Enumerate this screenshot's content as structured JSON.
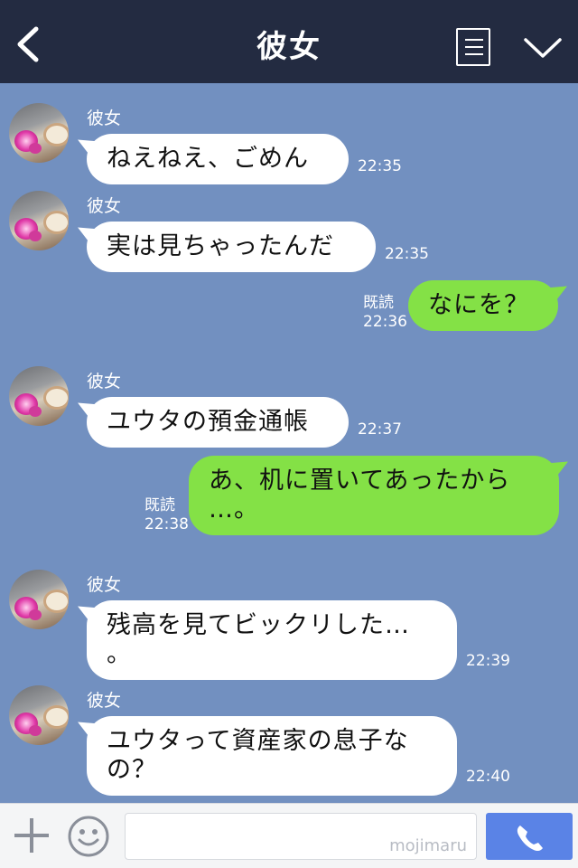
{
  "header": {
    "title": "彼女",
    "back_icon": "back-arrow-icon",
    "menu_icon": "list-menu-icon",
    "more_icon": "chevron-down-icon",
    "background": "#232b41"
  },
  "chat": {
    "background": "#7290c0",
    "incoming_bubble_color": "#ffffff",
    "outgoing_bubble_color": "#84e146",
    "messages": [
      {
        "direction": "in",
        "sender": "彼女",
        "text": "ねえねえ、ごめん",
        "time": "22:35"
      },
      {
        "direction": "in",
        "sender": "彼女",
        "text": "実は見ちゃったんだ",
        "time": "22:35"
      },
      {
        "direction": "out",
        "text": "なにを？",
        "read": "既読",
        "time": "22:36"
      },
      {
        "direction": "in",
        "sender": "彼女",
        "text": "ユウタの預金通帳",
        "time": "22:37"
      },
      {
        "direction": "out",
        "text_line1": "あ、机に置いてあったから",
        "text_line2": "…。",
        "read": "既読",
        "time": "22:38"
      },
      {
        "direction": "in",
        "sender": "彼女",
        "text_line1": "残高を見てビックリした…",
        "text_line2": "。",
        "time": "22:39"
      },
      {
        "direction": "in",
        "sender": "彼女",
        "text_line1": "ユウタって資産家の息子な",
        "text_line2": "の？",
        "time": "22:40"
      }
    ]
  },
  "footer": {
    "plus_icon": "plus-icon",
    "emoji_icon": "emoji-icon",
    "input_value": "",
    "watermark": "mojimaru",
    "call_icon": "phone-icon",
    "call_button_color": "#5a83e6"
  }
}
